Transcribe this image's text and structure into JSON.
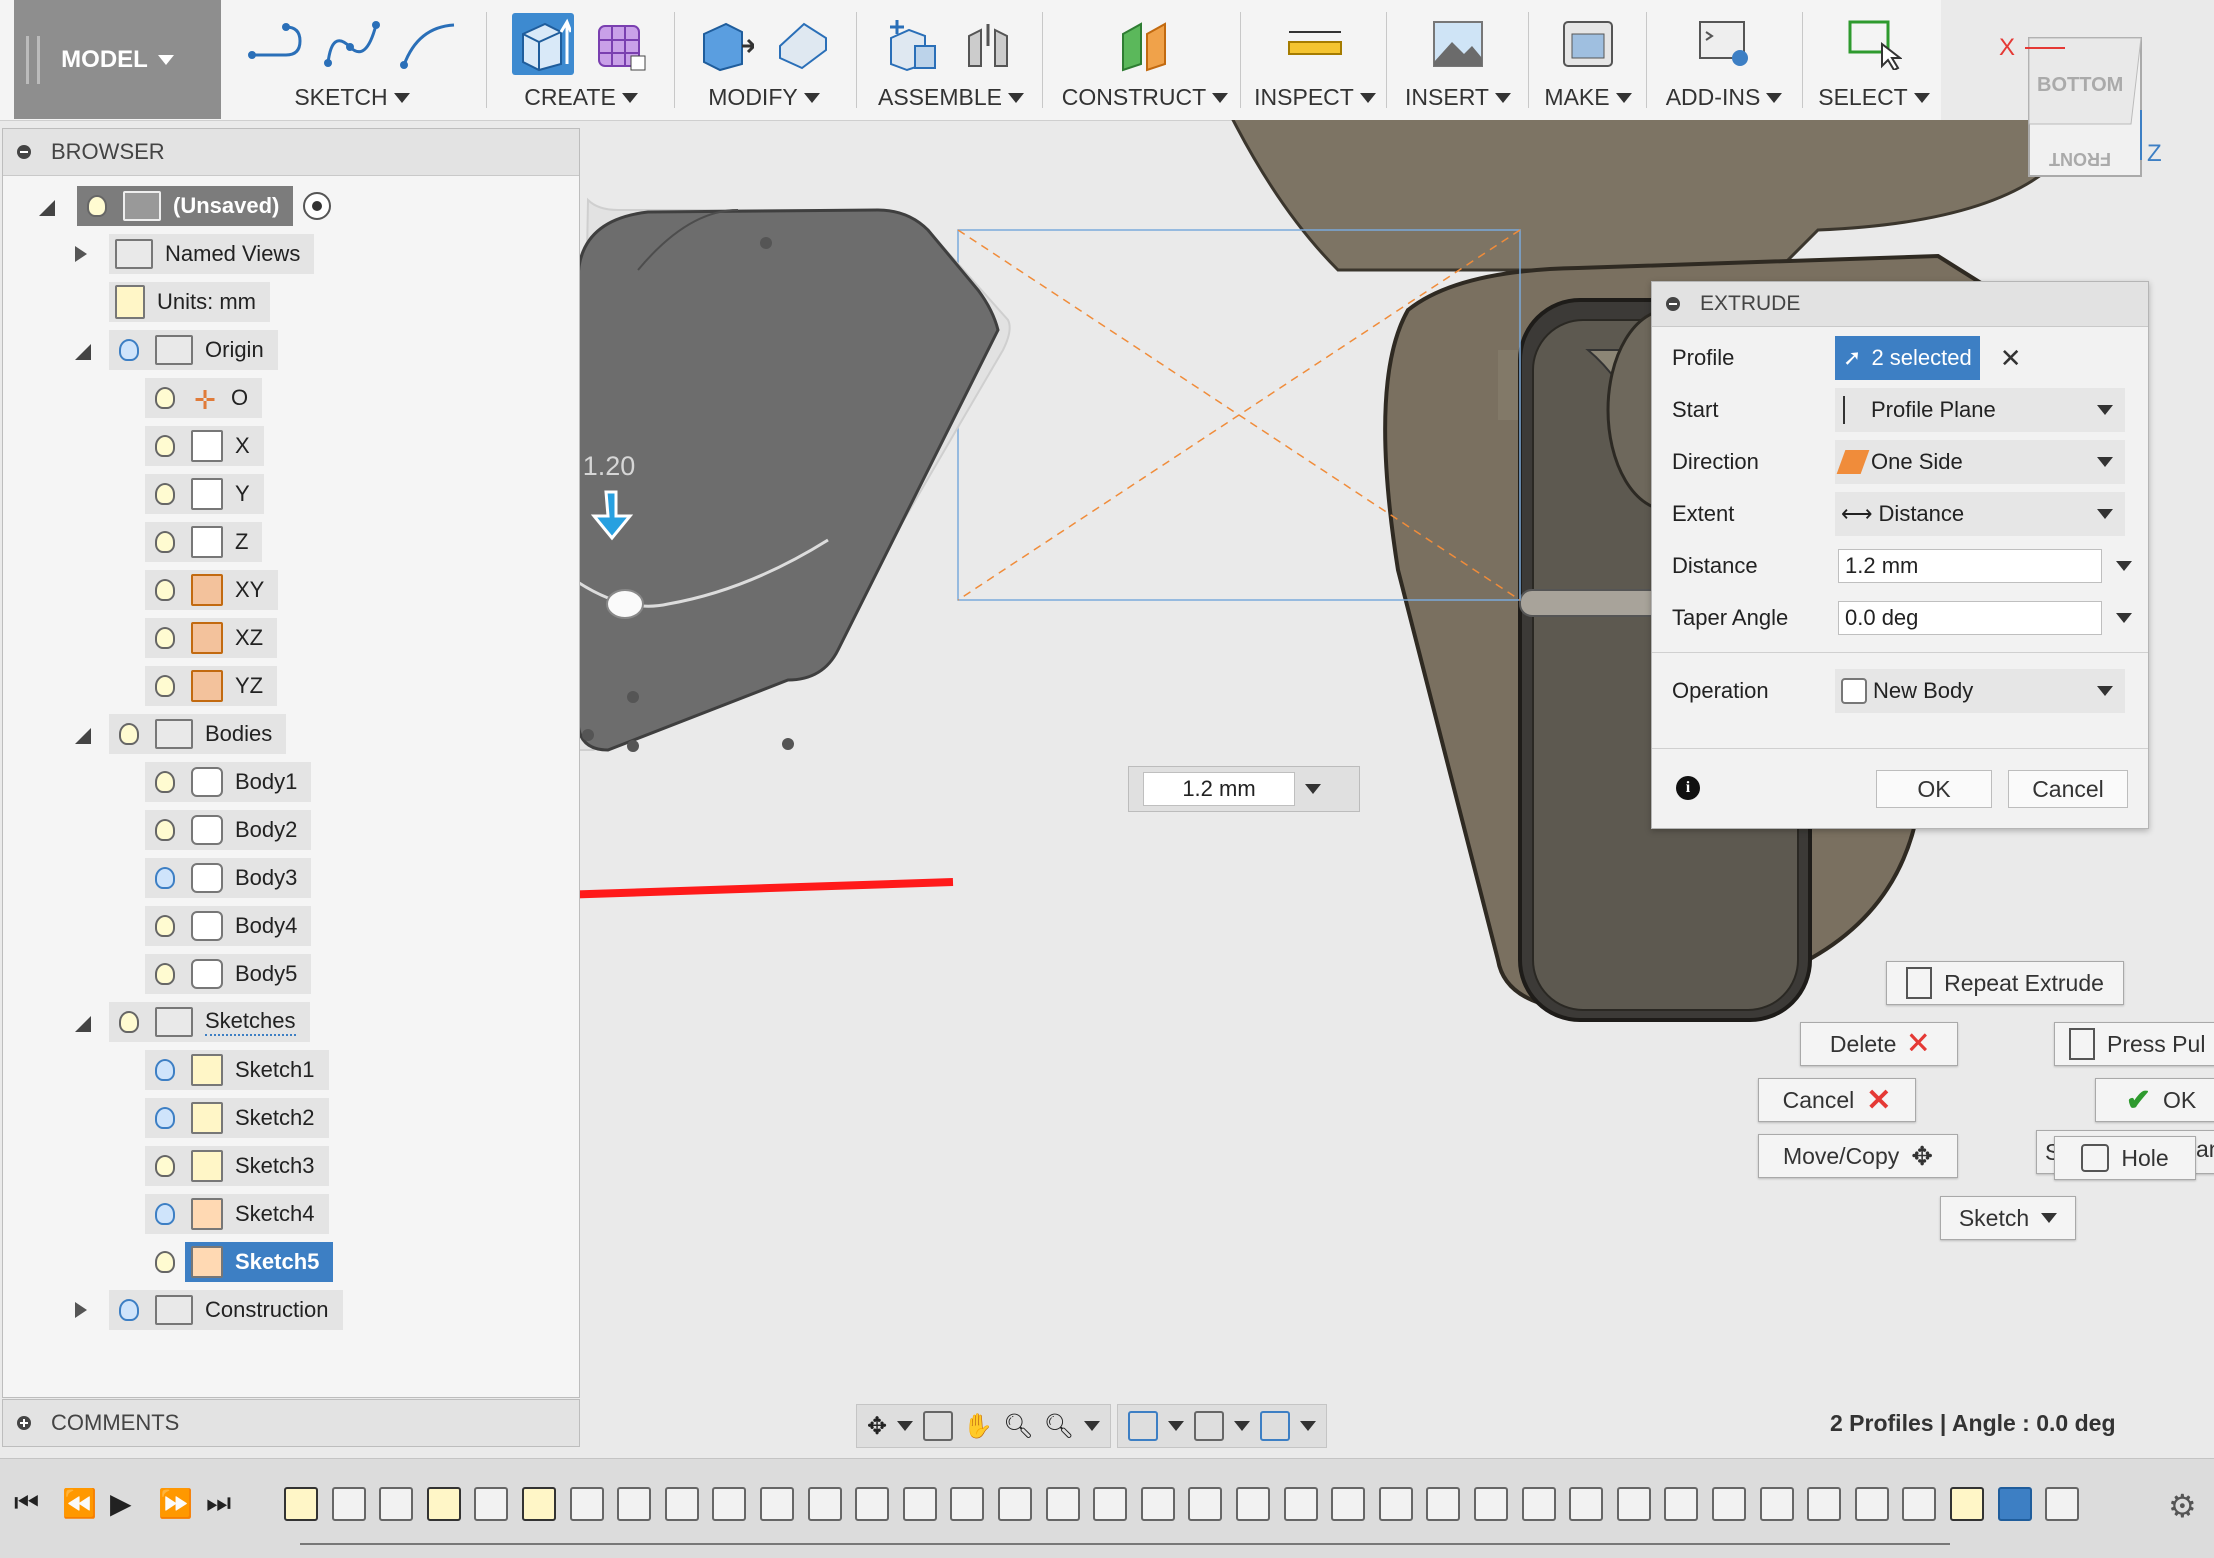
{
  "toolbar": {
    "workspace": "MODEL",
    "groups": {
      "sketch": "SKETCH",
      "create": "CREATE",
      "modify": "MODIFY",
      "assemble": "ASSEMBLE",
      "construct": "CONSTRUCT",
      "inspect": "INSPECT",
      "insert": "INSERT",
      "make": "MAKE",
      "addins": "ADD-INS",
      "select": "SELECT"
    }
  },
  "viewcube": {
    "bottom": "BOTTOM",
    "front": "FRONT",
    "x": "X",
    "z": "Z"
  },
  "browser": {
    "title": "BROWSER",
    "root": "(Unsaved)",
    "named_views": "Named Views",
    "units": "Units: mm",
    "origin": {
      "label": "Origin",
      "items": [
        "O",
        "X",
        "Y",
        "Z",
        "XY",
        "XZ",
        "YZ"
      ]
    },
    "bodies": {
      "label": "Bodies",
      "items": [
        "Body1",
        "Body2",
        "Body3",
        "Body4",
        "Body5"
      ]
    },
    "sketches": {
      "label": "Sketches",
      "items": [
        "Sketch1",
        "Sketch2",
        "Sketch3",
        "Sketch4",
        "Sketch5"
      ],
      "selected": "Sketch5"
    },
    "construction": "Construction"
  },
  "comments": "COMMENTS",
  "canvas": {
    "manipulator_value": "1.20",
    "distance_input": "1.2 mm",
    "arrow_color": "#ff0000"
  },
  "extrude": {
    "title": "EXTRUDE",
    "profile": {
      "label": "Profile",
      "value": "2 selected"
    },
    "start": {
      "label": "Start",
      "value": "Profile Plane"
    },
    "direction": {
      "label": "Direction",
      "value": "One Side"
    },
    "extent": {
      "label": "Extent",
      "value": "Distance"
    },
    "distance": {
      "label": "Distance",
      "value": "1.2 mm"
    },
    "taper": {
      "label": "Taper Angle",
      "value": "0.0 deg"
    },
    "operation": {
      "label": "Operation",
      "value": "New Body"
    },
    "ok": "OK",
    "cancel": "Cancel"
  },
  "marking_menu": {
    "repeat": "Repeat Extrude",
    "delete": "Delete",
    "press_pull": "Press Pul",
    "cancel": "Cancel",
    "ok": "OK",
    "move_copy": "Move/Copy",
    "hole": "Hole",
    "sketch": "Sketch",
    "partial_left": "S",
    "partial_right": "an"
  },
  "status": "2 Profiles | Angle : 0.0 deg",
  "colors": {
    "accent": "#3d7fc4",
    "body": "#6d6d6d",
    "model": "#7a7060"
  }
}
